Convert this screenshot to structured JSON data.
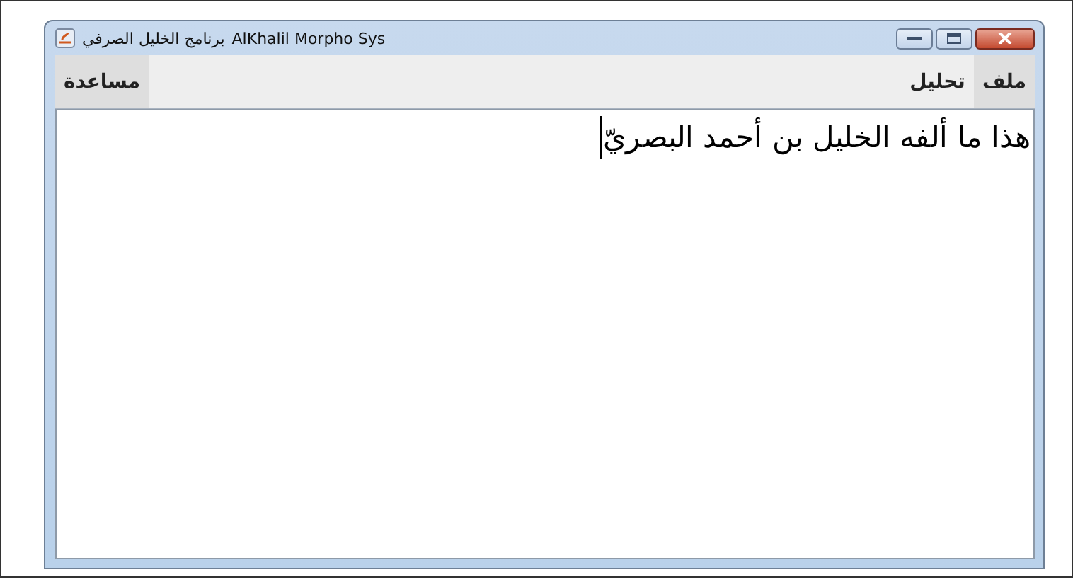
{
  "window": {
    "title_parts": [
      "AlKhalil Morpho Sys",
      "برنامج الخليل الصرفي"
    ]
  },
  "menu_right": [
    {
      "label": "ملف",
      "selected": true
    },
    {
      "label": "تحليل",
      "selected": false
    }
  ],
  "menu_left": [
    {
      "label": "مساعدة",
      "selected": true
    }
  ],
  "editor": {
    "text": "هذا ما ألفه الخليل بن أحمد البصريّ"
  }
}
